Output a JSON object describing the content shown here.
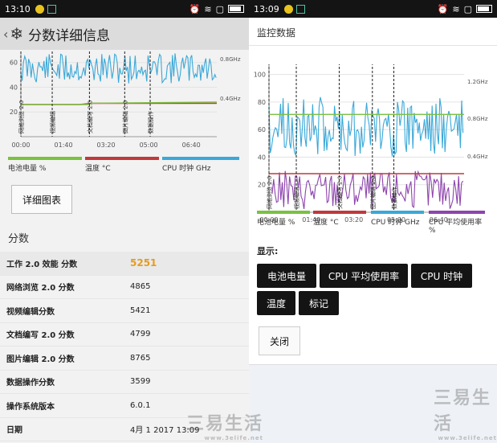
{
  "left": {
    "status": {
      "time": "13:10"
    },
    "title": "分数详细信息",
    "back_glyph": "‹",
    "chart": {
      "yticks": [
        "60",
        "40",
        "20"
      ],
      "rticks": [
        "0.8GHz",
        "0.4GHz"
      ],
      "xticks": [
        "00:00",
        "01:40",
        "03:20",
        "05:00",
        "06:40"
      ],
      "markers": [
        "网络浏览 2.0",
        "视频编辑",
        "文档编写 2.0",
        "图片编辑 2.0",
        "数据操作"
      ]
    },
    "legend": [
      {
        "label": "电池电量 %",
        "color": "#7ac143"
      },
      {
        "label": "温度 °C",
        "color": "#c0393b"
      },
      {
        "label": "CPU 时钟 GHz",
        "color": "#3aa8d8"
      }
    ],
    "detail_button": "详细图表",
    "section_label": "分数",
    "rows": [
      {
        "k": "工作 2.0 效能 分数",
        "v": "5251"
      },
      {
        "k": "网络浏览 2.0 分数",
        "v": "4865"
      },
      {
        "k": "视频编辑分数",
        "v": "5421"
      },
      {
        "k": "文档编写 2.0 分数",
        "v": "4799"
      },
      {
        "k": "图片编辑 2.0 分数",
        "v": "8765"
      },
      {
        "k": "数据操作分数",
        "v": "3599"
      },
      {
        "k": "操作系统版本",
        "v": "6.0.1"
      },
      {
        "k": "日期",
        "v": "4月 1 2017 13:09"
      }
    ]
  },
  "right": {
    "status": {
      "time": "13:09"
    },
    "title": "监控数据",
    "chart": {
      "yticks": [
        "100",
        "80",
        "60",
        "40",
        "20"
      ],
      "rticks": [
        "1.2GHz",
        "0.8GHz",
        "0.4GHz"
      ],
      "xticks": [
        "00:00",
        "01:40",
        "03:20",
        "05:00",
        "06:40"
      ],
      "markers": [
        "网络浏览 2.0",
        "视频编辑",
        "文档编写 2.0",
        "图片编辑 2.0",
        "数据操作"
      ]
    },
    "legend": [
      {
        "label": "电池电量 %",
        "color": "#7ac143"
      },
      {
        "label": "温度 °C",
        "color": "#c0393b"
      },
      {
        "label": "CPU 时钟 GHz",
        "color": "#3aa8d8"
      },
      {
        "label": "CPU 平均使用率 %",
        "color": "#8e44ad"
      }
    ],
    "show_label": "显示:",
    "toggles": [
      "电池电量",
      "CPU 平均使用率",
      "CPU 时钟",
      "温度",
      "标记"
    ],
    "close_button": "关闭"
  },
  "watermark": {
    "main": "三易生活",
    "url": "www.3elife.net"
  },
  "chart_data": [
    {
      "type": "line",
      "x": [
        "00:00",
        "01:40",
        "03:20",
        "05:00",
        "06:40"
      ],
      "series": [
        {
          "name": "电池电量 %",
          "values": [
            26,
            27,
            28,
            28,
            28
          ]
        },
        {
          "name": "温度 °C",
          "values": [
            26,
            26,
            27,
            27,
            27
          ]
        }
      ],
      "ylim": [
        0,
        65
      ]
    },
    {
      "type": "line",
      "x": [
        "00:00",
        "01:40",
        "03:20",
        "05:00",
        "06:40"
      ],
      "series": [
        {
          "name": "电池电量 %",
          "values": [
            71,
            71,
            71,
            71,
            71
          ]
        },
        {
          "name": "温度 °C",
          "values": [
            28,
            28,
            28,
            28,
            28
          ]
        },
        {
          "name": "CPU 平均使用率 %",
          "values": [
            18,
            22,
            15,
            12,
            10
          ]
        }
      ],
      "ylim": [
        0,
        105
      ]
    }
  ]
}
